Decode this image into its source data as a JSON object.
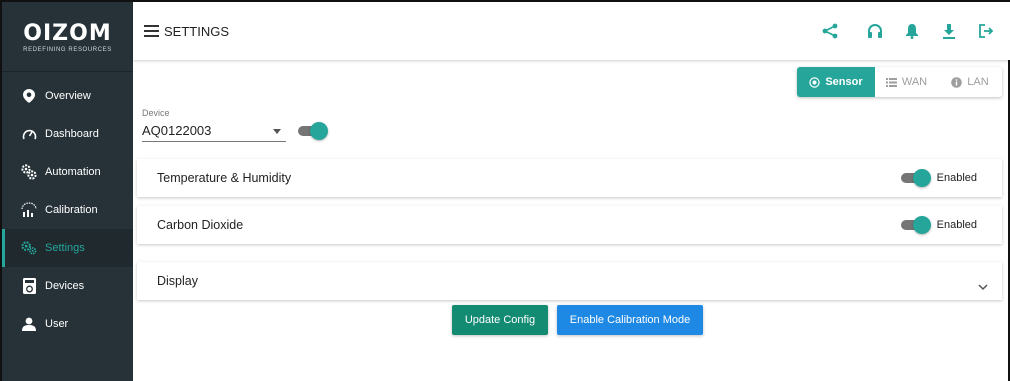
{
  "brand": {
    "logo": "OIZOM",
    "tagline": "REDEFINING RESOURCES"
  },
  "sidebar": {
    "items": [
      {
        "label": "Overview",
        "icon": "map-pin-icon"
      },
      {
        "label": "Dashboard",
        "icon": "speedometer-icon"
      },
      {
        "label": "Automation",
        "icon": "gears-icon"
      },
      {
        "label": "Calibration",
        "icon": "calibration-icon"
      },
      {
        "label": "Settings",
        "icon": "settings-gears-icon",
        "active": true
      },
      {
        "label": "Devices",
        "icon": "device-icon"
      },
      {
        "label": "User",
        "icon": "user-icon"
      }
    ]
  },
  "header": {
    "title": "SETTINGS",
    "icons": [
      "share-icon",
      "headset-icon",
      "bell-icon",
      "download-icon",
      "logout-icon"
    ]
  },
  "tabs": {
    "sensor": "Sensor",
    "wan": "WAN",
    "lan": "LAN"
  },
  "device": {
    "label": "Device",
    "value": "AQ0122003",
    "enabled": true
  },
  "panels": [
    {
      "title": "Temperature & Humidity",
      "status": "Enabled",
      "enabled": true
    },
    {
      "title": "Carbon Dioxide",
      "status": "Enabled",
      "enabled": true
    },
    {
      "title": "Display"
    }
  ],
  "actions": {
    "update": "Update Config",
    "calibration": "Enable Calibration Mode"
  },
  "colors": {
    "accent": "#26a69a",
    "sidebar": "#263238",
    "primary_button": "#138a72",
    "secondary_button": "#1e88e5"
  }
}
